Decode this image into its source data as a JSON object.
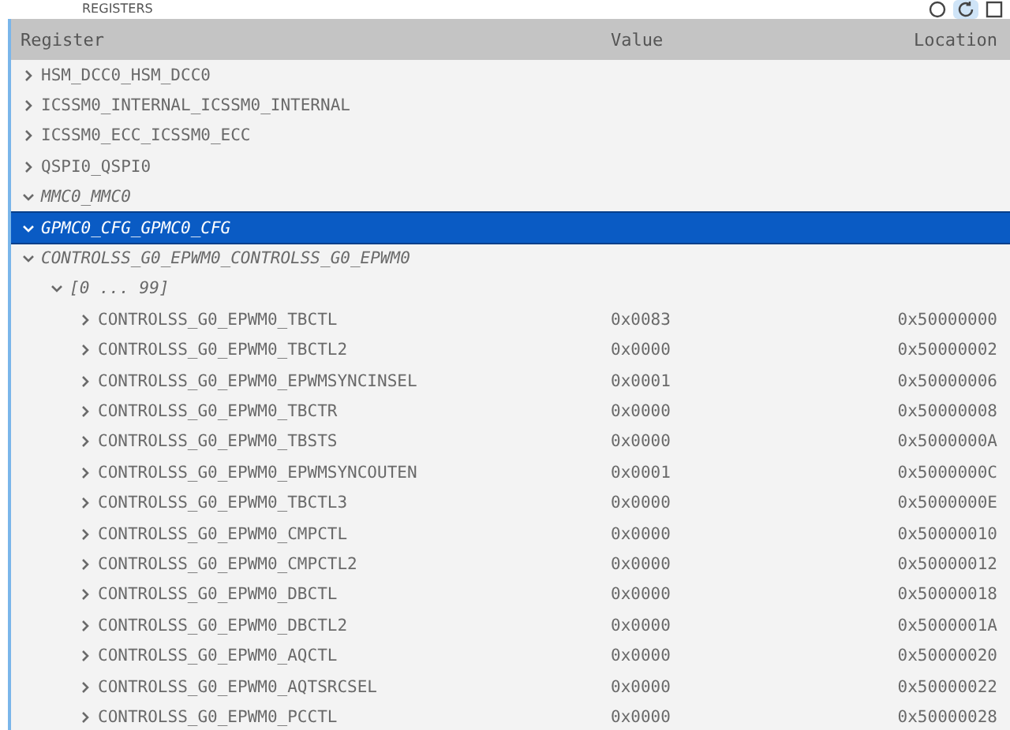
{
  "panel": {
    "title": "REGISTERS"
  },
  "columns": [
    "Register",
    "Value",
    "Location"
  ],
  "rows": [
    {
      "name": "HSM_DCC0_HSM_DCC0",
      "expanded": false,
      "selected": false
    },
    {
      "name": "ICSSM0_INTERNAL_ICSSM0_INTERNAL",
      "expanded": false,
      "selected": false
    },
    {
      "name": "ICSSM0_ECC_ICSSM0_ECC",
      "expanded": false,
      "selected": false
    },
    {
      "name": "QSPI0_QSPI0",
      "expanded": false,
      "selected": false
    },
    {
      "name": "MMC0_MMC0",
      "expanded": true,
      "selected": false
    },
    {
      "name": "GPMC0_CFG_GPMC0_CFG",
      "expanded": true,
      "selected": true
    },
    {
      "name": "CONTROLSS_G0_EPWM0_CONTROLSS_G0_EPWM0",
      "expanded": true,
      "selected": false,
      "children": [
        {
          "name": "[0 ... 99]",
          "expanded": true,
          "selected": false,
          "children": [
            {
              "name": "CONTROLSS_G0_EPWM0_TBCTL",
              "value": "0x0083",
              "location": "0x50000000",
              "expanded": false,
              "selected": false
            },
            {
              "name": "CONTROLSS_G0_EPWM0_TBCTL2",
              "value": "0x0000",
              "location": "0x50000002",
              "expanded": false,
              "selected": false
            },
            {
              "name": "CONTROLSS_G0_EPWM0_EPWMSYNCINSEL",
              "value": "0x0001",
              "location": "0x50000006",
              "expanded": false,
              "selected": false
            },
            {
              "name": "CONTROLSS_G0_EPWM0_TBCTR",
              "value": "0x0000",
              "location": "0x50000008",
              "expanded": false,
              "selected": false
            },
            {
              "name": "CONTROLSS_G0_EPWM0_TBSTS",
              "value": "0x0000",
              "location": "0x5000000A",
              "expanded": false,
              "selected": false
            },
            {
              "name": "CONTROLSS_G0_EPWM0_EPWMSYNCOUTEN",
              "value": "0x0001",
              "location": "0x5000000C",
              "expanded": false,
              "selected": false
            },
            {
              "name": "CONTROLSS_G0_EPWM0_TBCTL3",
              "value": "0x0000",
              "location": "0x5000000E",
              "expanded": false,
              "selected": false
            },
            {
              "name": "CONTROLSS_G0_EPWM0_CMPCTL",
              "value": "0x0000",
              "location": "0x50000010",
              "expanded": false,
              "selected": false
            },
            {
              "name": "CONTROLSS_G0_EPWM0_CMPCTL2",
              "value": "0x0000",
              "location": "0x50000012",
              "expanded": false,
              "selected": false
            },
            {
              "name": "CONTROLSS_G0_EPWM0_DBCTL",
              "value": "0x0000",
              "location": "0x50000018",
              "expanded": false,
              "selected": false
            },
            {
              "name": "CONTROLSS_G0_EPWM0_DBCTL2",
              "value": "0x0000",
              "location": "0x5000001A",
              "expanded": false,
              "selected": false
            },
            {
              "name": "CONTROLSS_G0_EPWM0_AQCTL",
              "value": "0x0000",
              "location": "0x50000020",
              "expanded": false,
              "selected": false
            },
            {
              "name": "CONTROLSS_G0_EPWM0_AQTSRCSEL",
              "value": "0x0000",
              "location": "0x50000022",
              "expanded": false,
              "selected": false
            },
            {
              "name": "CONTROLSS_G0_EPWM0_PCCTL",
              "value": "0x0000",
              "location": "0x50000028",
              "expanded": false,
              "selected": false
            }
          ]
        }
      ]
    }
  ]
}
